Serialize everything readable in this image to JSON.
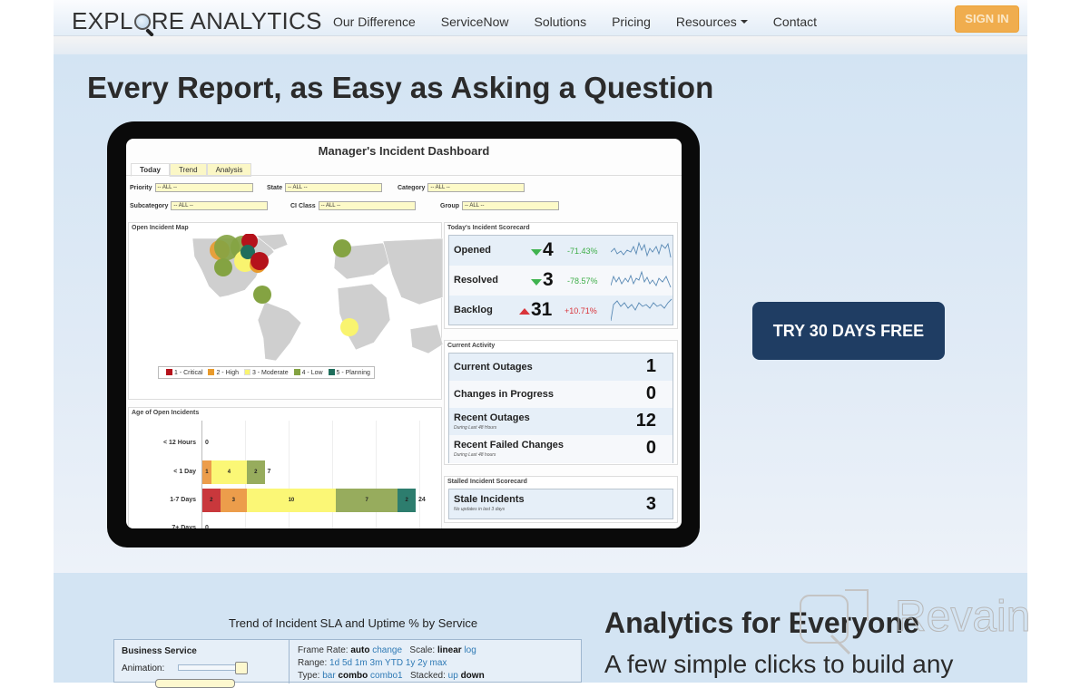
{
  "header": {
    "logo": "EXPLORE ANALYTICS",
    "logo_parts": [
      "EXPL",
      "RE ANALYTICS"
    ],
    "nav": [
      "Our Difference",
      "ServiceNow",
      "Solutions",
      "Pricing",
      "Resources",
      "Contact"
    ],
    "signin": "SIGN IN",
    "signin_color": "#f0ad4e"
  },
  "hero": {
    "title": "Every Report, as Easy as Asking a Question",
    "cta": "TRY 30 DAYS FREE",
    "cta_color": "#1f3d63"
  },
  "dashboard": {
    "title": "Manager's Incident Dashboard",
    "tabs": [
      "Today",
      "Trend",
      "Analysis"
    ],
    "active_tab": "Today",
    "filters": [
      {
        "label": "Priority",
        "value": "-- ALL --"
      },
      {
        "label": "State",
        "value": "-- ALL --"
      },
      {
        "label": "Category",
        "value": "-- ALL --"
      },
      {
        "label": "Subcategory",
        "value": "-- ALL --"
      },
      {
        "label": "CI Class",
        "value": "-- ALL --"
      },
      {
        "label": "Group",
        "value": "-- ALL --"
      }
    ],
    "map": {
      "title": "Open Incident Map",
      "legend": [
        {
          "label": "1 - Critical",
          "color": "#b5121b"
        },
        {
          "label": "2 - High",
          "color": "#e89a2c"
        },
        {
          "label": "3 - Moderate",
          "color": "#f9f46f"
        },
        {
          "label": "4 - Low",
          "color": "#84a342"
        },
        {
          "label": "5 - Planning",
          "color": "#1f6e5c"
        }
      ]
    },
    "scorecard": {
      "title": "Today's Incident Scorecard",
      "rows": [
        {
          "label": "Opened",
          "value": "4",
          "trend": "down",
          "change": "-71.43%",
          "change_color": "#3fae49"
        },
        {
          "label": "Resolved",
          "value": "3",
          "trend": "down",
          "change": "-78.57%",
          "change_color": "#3fae49"
        },
        {
          "label": "Backlog",
          "value": "31",
          "trend": "up",
          "change": "+10.71%",
          "change_color": "#d9343a"
        }
      ]
    },
    "activity": {
      "title": "Current Activity",
      "rows": [
        {
          "label": "Current Outages",
          "sub": "",
          "value": "1"
        },
        {
          "label": "Changes in Progress",
          "sub": "",
          "value": "0"
        },
        {
          "label": "Recent Outages",
          "sub": "During Last 48 Hours",
          "value": "12"
        },
        {
          "label": "Recent Failed Changes",
          "sub": "During Last 48 hours",
          "value": "0"
        }
      ]
    },
    "stalled": {
      "title": "Stalled Incident Scorecard",
      "label": "Stale Incidents",
      "sub": "No updates in last 3 days",
      "value": "3"
    },
    "age": {
      "title": "Age of Open Incidents",
      "categories": [
        "< 12 Hours",
        "< 1 Day",
        "1-7 Days",
        "7+ Days"
      ],
      "series_colors": [
        "#c9383c",
        "#ec9d4b",
        "#fbf776",
        "#97ac5d",
        "#2d7d6e"
      ],
      "segments": [
        [
          0,
          0,
          0,
          0,
          0
        ],
        [
          0,
          1,
          4,
          2,
          0
        ],
        [
          2,
          3,
          10,
          7,
          2
        ],
        [
          0,
          0,
          0,
          0,
          0
        ]
      ],
      "totals": [
        "0",
        "7",
        "24",
        "0"
      ],
      "max": 24
    }
  },
  "trend": {
    "title": "Trend of Incident SLA and Uptime % by Service",
    "business_service": "Business Service",
    "animation_label": "Animation:",
    "frame_rate_label": "Frame Rate:",
    "frame_rate_value": "auto",
    "frame_rate_link": "change",
    "scale_label": "Scale:",
    "scale_value": "linear",
    "scale_link": "log",
    "range_label": "Range:",
    "range_links": [
      "1d",
      "5d",
      "1m",
      "3m",
      "YTD",
      "1y",
      "2y",
      "max"
    ],
    "type_label": "Type:",
    "type_link1": "bar",
    "type_value": "combo",
    "type_link2": "combo1",
    "stacked_label": "Stacked:",
    "stacked_link": "up",
    "stacked_value": "down"
  },
  "analytics": {
    "title": "Analytics for Everyone",
    "subtitle": "A few simple clicks to build any"
  },
  "watermark": "Revain"
}
